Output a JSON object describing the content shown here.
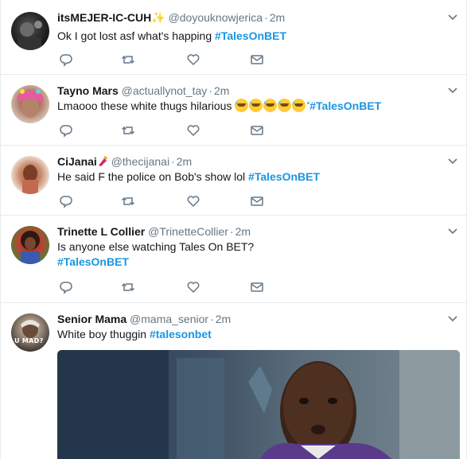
{
  "tweets": [
    {
      "name": "itsMEJER-IC-CUH",
      "name_suffix": "✨",
      "handle": "@doyouknowjerica",
      "time": "2m",
      "text": "Ok I got lost asf what's happing ",
      "hashtag": "#TalesOnBET"
    },
    {
      "name": "Tayno Mars",
      "handle": "@actuallynot_tay",
      "time": "2m",
      "text": "Lmaooo these white thugs hilarious ",
      "emoji_count": 5,
      "hashtag": "#TalesOnBET"
    },
    {
      "name": "CiJanai",
      "handle": "@thecijanai",
      "time": "2m",
      "text": "He said F the police on Bob's show lol ",
      "hashtag": "#TalesOnBET"
    },
    {
      "name": "Trinette L Collier",
      "handle": "@TrinetteCollier",
      "time": "2m",
      "text": "Is anyone else watching Tales On BET?",
      "hashtag": "#TalesOnBET"
    },
    {
      "name": "Senior Mama",
      "handle": "@mama_senior",
      "time": "2m",
      "text": "White boy thuggin ",
      "hashtag": "#talesonbet",
      "avatar_badge": "U MAD?"
    }
  ],
  "dot": "·",
  "colors": {
    "hashtag": "#1b95e0",
    "meta": "#657786",
    "border": "#e6ecf0"
  },
  "icons": [
    "reply-icon",
    "retweet-icon",
    "like-icon",
    "dm-icon",
    "caret-down-icon"
  ]
}
